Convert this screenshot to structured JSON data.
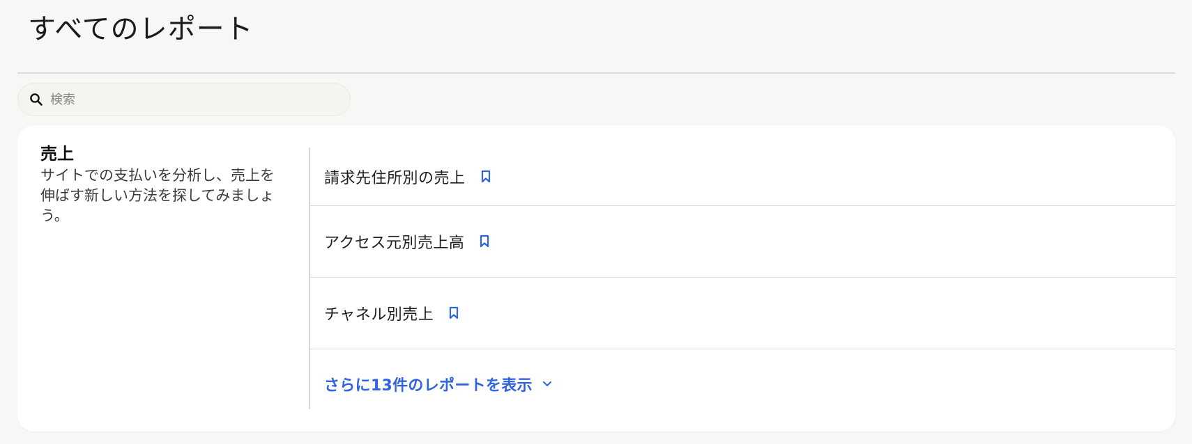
{
  "page": {
    "title": "すべてのレポート"
  },
  "search": {
    "placeholder": "検索",
    "value": ""
  },
  "category": {
    "title": "売上",
    "description": "サイトでの支払いを分析し、売上を伸ばす新しい方法を探してみましょう。"
  },
  "reports": [
    {
      "label": "請求先住所別の売上",
      "icon": "bookmark-icon"
    },
    {
      "label": "アクセス元別売上高",
      "icon": "bookmark-icon"
    },
    {
      "label": "チャネル別売上",
      "icon": "bookmark-icon"
    }
  ],
  "more": {
    "label": "さらに13件のレポートを表示",
    "icon": "chevron-down-icon"
  },
  "colors": {
    "accent": "#2f63e0",
    "background": "#f8f7f5",
    "card": "#ffffff"
  }
}
